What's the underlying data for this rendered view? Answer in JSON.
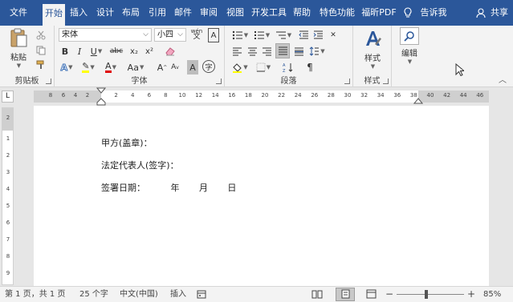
{
  "menu": {
    "tabs": [
      "文件",
      "开始",
      "插入",
      "设计",
      "布局",
      "引用",
      "邮件",
      "审阅",
      "视图",
      "开发工具",
      "帮助",
      "特色功能",
      "福昕PDF"
    ],
    "active": "开始",
    "tell_me": "告诉我",
    "share": "共享"
  },
  "ribbon": {
    "clipboard": {
      "label": "剪贴板",
      "paste": "粘贴"
    },
    "font": {
      "label": "字体",
      "font_name": "宋体",
      "font_size": "小四",
      "wen": "wén",
      "bold": "B",
      "italic": "I",
      "underline": "U",
      "strike": "abc",
      "sub": "x₂",
      "sup": "x²",
      "font_color": "A",
      "change_case": "Aa",
      "grow": "A",
      "shrink": "A",
      "char_shade": "A",
      "enclose": "字"
    },
    "paragraph": {
      "label": "段落"
    },
    "styles": {
      "label": "样式",
      "button": "样式"
    },
    "editing": {
      "button": "编辑"
    }
  },
  "ruler": {
    "corner": "L",
    "left_numbers": [
      "8",
      "6",
      "4",
      "2"
    ],
    "right_numbers": [
      "2",
      "4",
      "6",
      "8",
      "10",
      "12",
      "14",
      "16",
      "18",
      "20",
      "22",
      "24",
      "26",
      "28",
      "30",
      "32",
      "34",
      "36",
      "38",
      "40",
      "42",
      "44",
      "46"
    ],
    "vertical_numbers": [
      "2",
      "1",
      "2",
      "3",
      "4",
      "5",
      "6",
      "7",
      "8",
      "9",
      "10"
    ]
  },
  "document": {
    "lines": [
      "甲方(盖章)：",
      "法定代表人(签字)：",
      "签署日期：         年       月       日"
    ]
  },
  "status": {
    "page": "第 1 页，共 1 页",
    "words": "25 个字",
    "language": "中文(中国)",
    "mode": "插入",
    "zoom": "85%"
  },
  "colors": {
    "accent": "#2b579a",
    "highlight": "#ffff00",
    "font_red": "#e00000"
  }
}
